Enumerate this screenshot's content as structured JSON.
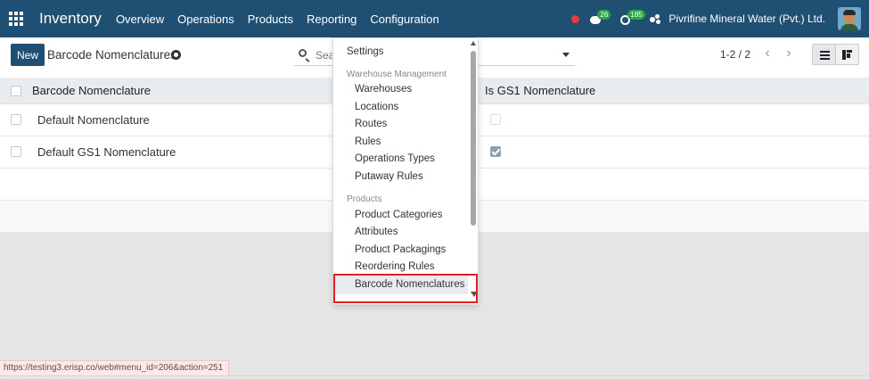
{
  "navbar": {
    "brand": "Inventory",
    "menu": [
      "Overview",
      "Operations",
      "Products",
      "Reporting",
      "Configuration"
    ],
    "chat_count": "26",
    "activity_count": "185",
    "company": "Pivrifine Mineral Water (Pvt.) Ltd."
  },
  "control": {
    "new_label": "New",
    "breadcrumb": "Barcode Nomenclatures",
    "search_placeholder": "Search...",
    "pager": "1-2 / 2"
  },
  "table": {
    "col_name": "Barcode Nomenclature",
    "col_gs1": "Is GS1 Nomenclature",
    "rows": [
      {
        "name": "Default Nomenclature",
        "is_gs1": false
      },
      {
        "name": "Default GS1 Nomenclature",
        "is_gs1": true
      }
    ]
  },
  "dropdown": {
    "settings": "Settings",
    "sections": [
      {
        "header": "Warehouse Management",
        "items": [
          "Warehouses",
          "Locations",
          "Routes",
          "Rules",
          "Operations Types",
          "Putaway Rules"
        ]
      },
      {
        "header": "Products",
        "items": [
          "Product Categories",
          "Attributes",
          "Product Packagings",
          "Reordering Rules",
          "Barcode Nomenclatures"
        ]
      }
    ],
    "active_item": "Barcode Nomenclatures"
  },
  "status_url": "https://testing3.erisp.co/web#menu_id=206&action=251",
  "colors": {
    "navbar": "#1f4f72",
    "highlight_frame": "#e01f25",
    "badge": "#28a745"
  }
}
